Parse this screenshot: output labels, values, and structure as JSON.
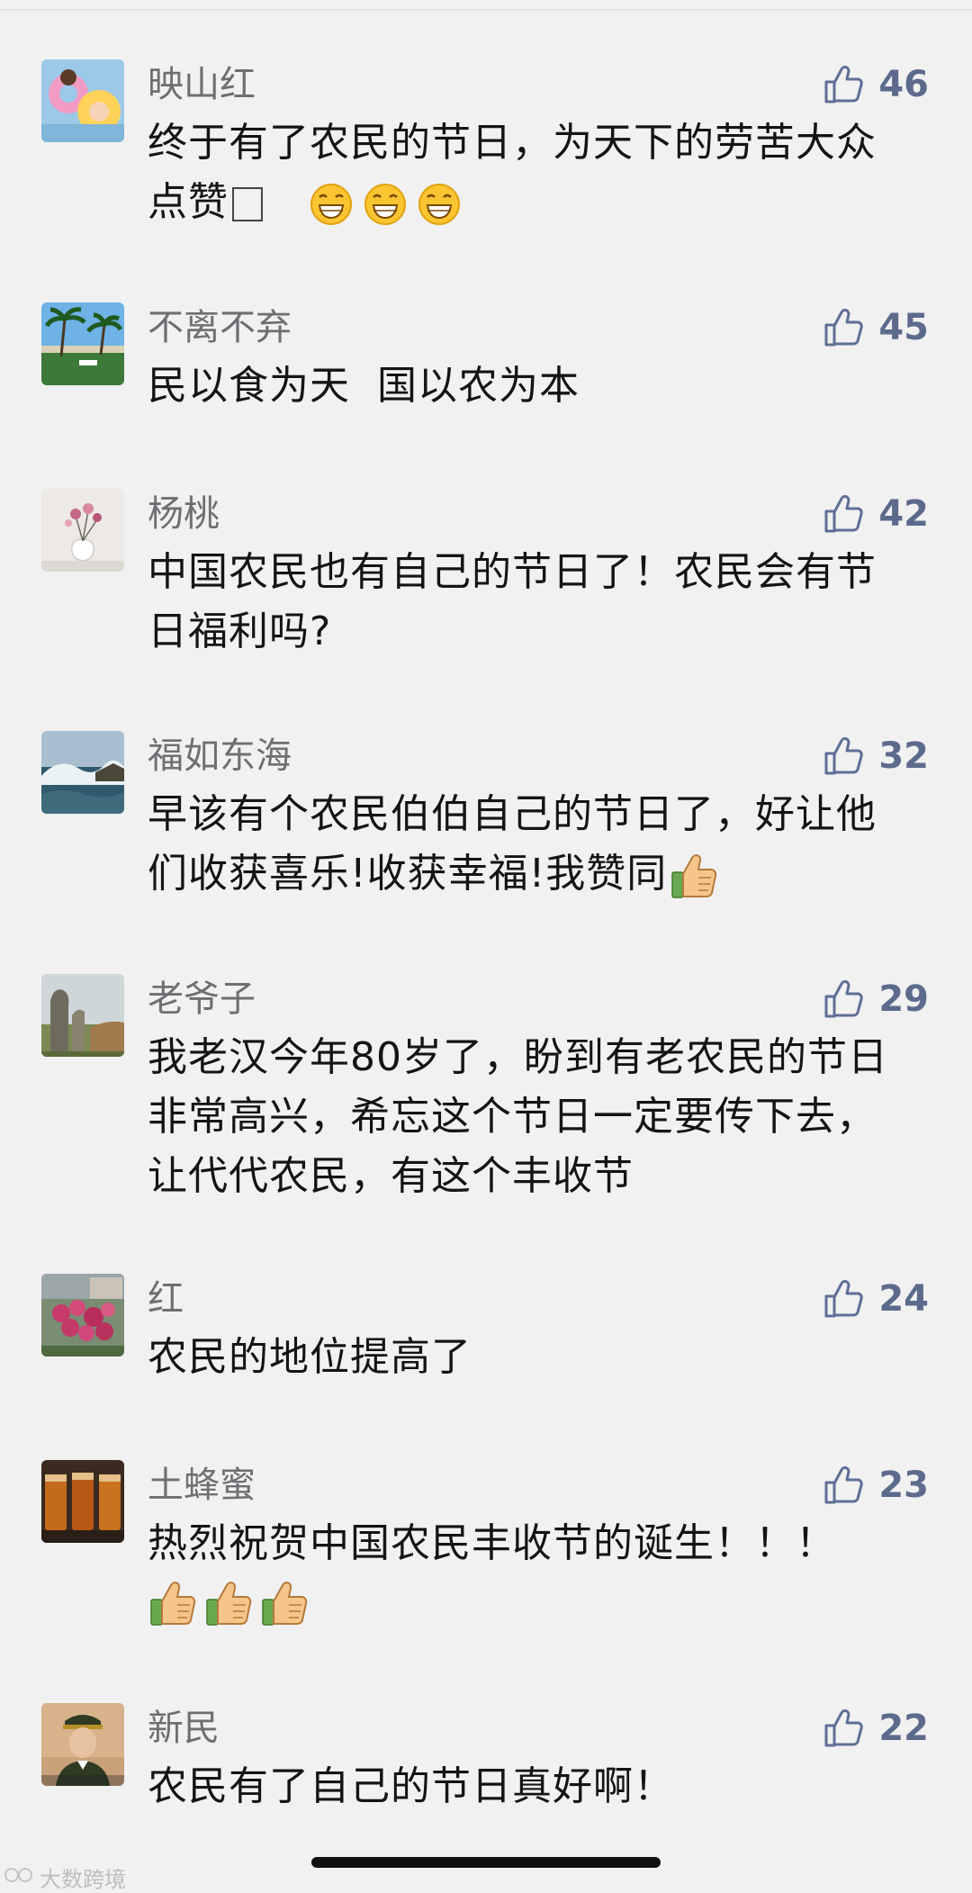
{
  "comments": [
    {
      "name": "映山红",
      "text": "终于有了农民的节日，为天下的劳苦大众点赞",
      "likes": "46",
      "avatar": "child-swimming-ring-avatar"
    },
    {
      "name": "不离不弃",
      "text": "民以食为天  国以农为本",
      "likes": "45",
      "avatar": "beach-palm-avatar"
    },
    {
      "name": "杨桃",
      "text": "中国农民也有自己的节日了！农民会有节日福利吗?",
      "likes": "42",
      "avatar": "flower-vase-avatar"
    },
    {
      "name": "福如东海",
      "text": "早该有个农民伯伯自己的节日了，好让他们收获喜乐!收获幸福!我赞同",
      "likes": "32",
      "avatar": "sea-waves-avatar"
    },
    {
      "name": "老爷子",
      "text": "我老汉今年80岁了，盼到有老农民的节日非常高兴，希忘这个节日一定要传下去，让代代农民，有这个丰收节",
      "likes": "29",
      "avatar": "stone-statue-avatar"
    },
    {
      "name": "红",
      "text": "农民的地位提高了",
      "likes": "24",
      "avatar": "rose-bush-avatar"
    },
    {
      "name": "土蜂蜜",
      "text": "热烈祝贺中国农民丰收节的诞生！！！",
      "likes": "23",
      "avatar": "honey-jars-avatar"
    },
    {
      "name": "新民",
      "text": "农民有了自己的节日真好啊！",
      "likes": "22",
      "avatar": "officer-portrait-avatar"
    }
  ],
  "watermark": "大数跨境",
  "colors": {
    "background": "#f1f1f2",
    "name": "#6f6f73",
    "like": "#5e6f96",
    "text": "#141414"
  }
}
